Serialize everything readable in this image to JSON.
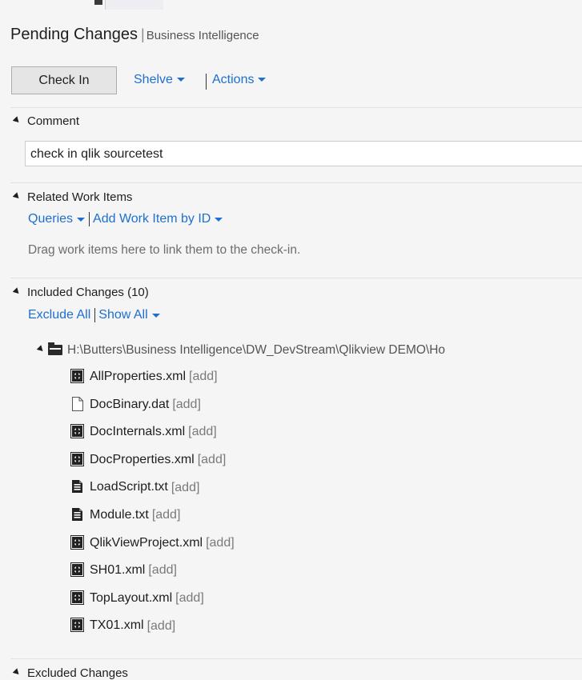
{
  "header": {
    "title": "Pending Changes",
    "separator": "|",
    "subtitle": "Business Intelligence"
  },
  "toolbar": {
    "check_in": "Check In",
    "shelve": "Shelve",
    "actions": "Actions"
  },
  "comment": {
    "heading": "Comment",
    "value": "check in qlik sourcetest"
  },
  "related": {
    "heading": "Related Work Items",
    "queries": "Queries",
    "add_by_id": "Add Work Item by ID",
    "hint": "Drag work items here to link them to the check-in."
  },
  "included": {
    "heading": "Included Changes (10)",
    "exclude_all": "Exclude All",
    "show_all": "Show All",
    "folder_path": "H:\\Butters\\Business Intelligence\\DW_DevStream\\Qlikview DEMO\\Ho",
    "files": [
      {
        "name": "AllProperties.xml",
        "status": "[add]",
        "icon": "xml-file-icon"
      },
      {
        "name": "DocBinary.dat",
        "status": "[add]",
        "icon": "blank-file-icon"
      },
      {
        "name": "DocInternals.xml",
        "status": "[add]",
        "icon": "xml-file-icon"
      },
      {
        "name": "DocProperties.xml",
        "status": "[add]",
        "icon": "xml-file-icon"
      },
      {
        "name": "LoadScript.txt",
        "status": "[add]",
        "icon": "text-file-icon"
      },
      {
        "name": "Module.txt",
        "status": "[add]",
        "icon": "text-file-icon"
      },
      {
        "name": "QlikViewProject.xml",
        "status": "[add]",
        "icon": "xml-file-icon"
      },
      {
        "name": "SH01.xml",
        "status": "[add]",
        "icon": "xml-file-icon"
      },
      {
        "name": "TopLayout.xml",
        "status": "[add]",
        "icon": "xml-file-icon"
      },
      {
        "name": "TX01.xml",
        "status": "[add]",
        "icon": "xml-file-icon"
      }
    ]
  },
  "excluded": {
    "heading": "Excluded Changes"
  },
  "colors": {
    "link": "#1e6fd0",
    "background": "#f5f5f5",
    "status_tag": "#7a7a7a"
  }
}
